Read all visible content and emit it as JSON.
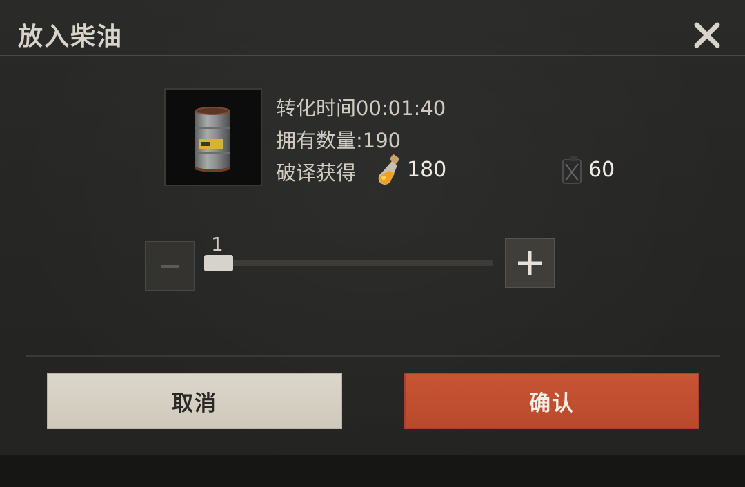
{
  "dialog": {
    "title": "放入柴油",
    "close_icon": "close-x-icon"
  },
  "item": {
    "icon": "oil-barrel-icon",
    "convert_time": "转化时间00:01:40",
    "owned_count": "拥有数量:190",
    "yield_label": "破译获得",
    "yields": [
      {
        "icon": "orange-potion-bottle-icon",
        "value": "180"
      },
      {
        "icon": "jerry-can-icon",
        "value": "60"
      }
    ]
  },
  "quantity": {
    "value": "1",
    "min": 1,
    "max": 190,
    "minus_icon": "minus-icon",
    "plus_icon": "plus-icon"
  },
  "buttons": {
    "cancel": "取消",
    "confirm": "确认"
  },
  "colors": {
    "confirm": "#c05030",
    "cancel": "#d8d3c6",
    "panel": "#262624"
  }
}
